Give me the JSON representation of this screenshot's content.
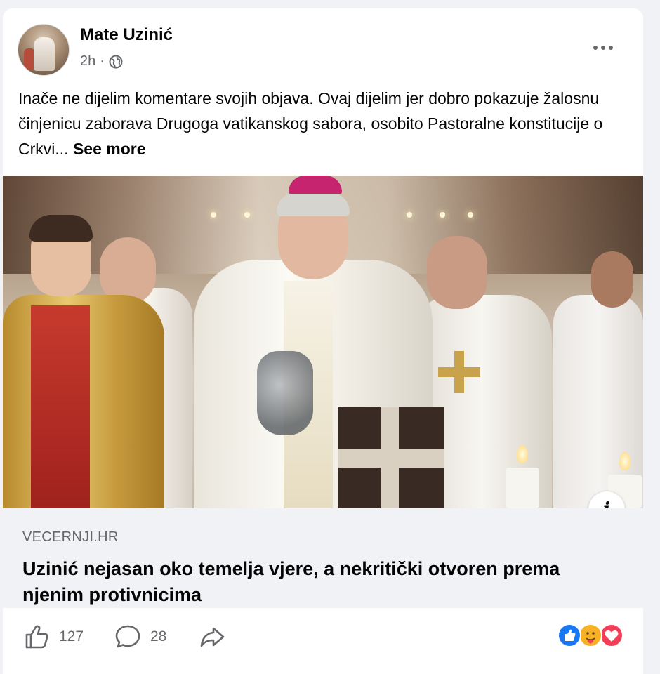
{
  "post": {
    "author": "Mate Uzinić",
    "time": "2h",
    "separator": "·",
    "privacy_icon": "globe-icon",
    "text": "Inače ne dijelim komentare svojih objava. Ovaj dijelim jer dobro pokazuje žalosnu činjenicu zaborava Drugoga vatikanskog sabora, osobito Pastoralne konstitucije o Crkvi...",
    "see_more": "See more"
  },
  "link": {
    "domain": "VECERNJI.HR",
    "title": "Uzinić nejasan oko temelja vjere, a nekritički otvoren prema njenim protivnicima"
  },
  "actions": {
    "like_count": "127",
    "comment_count": "28"
  },
  "colors": {
    "like_blue": "#1877f2",
    "love_red": "#f33e58",
    "care_yellow": "#f7b125",
    "secondary_text": "#65676b",
    "preview_bg": "#f0f2f5"
  }
}
